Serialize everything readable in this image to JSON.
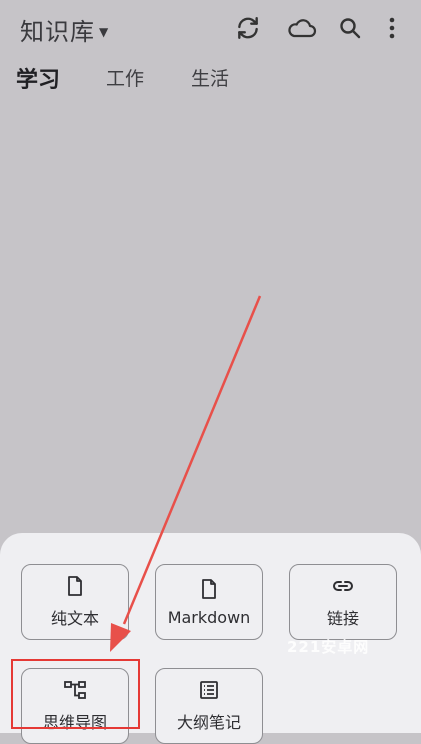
{
  "header": {
    "title": "知识库",
    "actions": [
      {
        "name": "sync-icon"
      },
      {
        "name": "cloud-icon"
      },
      {
        "name": "search-icon"
      },
      {
        "name": "more-vert-icon"
      }
    ]
  },
  "tabs": [
    {
      "label": "学习",
      "active": true
    },
    {
      "label": "工作",
      "active": false
    },
    {
      "label": "生活",
      "active": false
    }
  ],
  "sheet": {
    "items": [
      {
        "label": "纯文本",
        "icon": "document-icon"
      },
      {
        "label": "Markdown",
        "icon": "document-icon"
      },
      {
        "label": "链接",
        "icon": "link-icon"
      },
      {
        "label": "思维导图",
        "icon": "mindmap-icon"
      },
      {
        "label": "大纲笔记",
        "icon": "outline-icon"
      }
    ]
  },
  "watermark": "221安卓网",
  "colors": {
    "background": "#c6c4c8",
    "sheet": "#efeff2",
    "annotation": "#e53935"
  }
}
